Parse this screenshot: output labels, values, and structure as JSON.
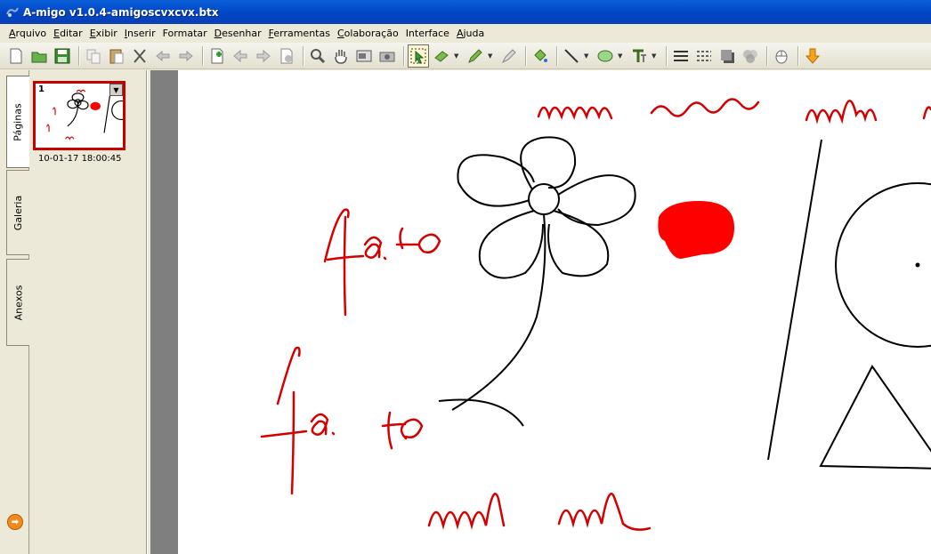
{
  "window": {
    "title": "A-migo v1.0.4-amigoscvxcvx.btx"
  },
  "menu": [
    {
      "ul": "A",
      "rest": "rquivo"
    },
    {
      "ul": "E",
      "rest": "ditar"
    },
    {
      "ul": "E",
      "rest": "xibir"
    },
    {
      "ul": "I",
      "rest": "nserir"
    },
    {
      "ul": "",
      "rest": "Formatar"
    },
    {
      "ul": "D",
      "rest": "esenhar"
    },
    {
      "ul": "F",
      "rest": "erramentas"
    },
    {
      "ul": "C",
      "rest": "olaboração"
    },
    {
      "ul": "",
      "rest": "Interface"
    },
    {
      "ul": "A",
      "rest": "juda"
    }
  ],
  "toolbar": {
    "icons": [
      "new-icon",
      "open-icon",
      "save-icon",
      "copy-icon",
      "paste-icon",
      "cut-icon",
      "undo-icon",
      "redo-icon",
      "add-page-icon",
      "previous-page-icon",
      "next-page-icon",
      "play-icon",
      "zoom-icon",
      "hand-icon",
      "screen-capture-icon",
      "camera-icon",
      "select-icon",
      "eraser-icon",
      "pen-icon",
      "highlighter-icon",
      "fill-icon",
      "line-icon",
      "shape-icon",
      "text-icon",
      "line-width-icon",
      "line-style-icon",
      "shadow-icon",
      "transparency-icon",
      "mouse-icon",
      "download-icon"
    ]
  },
  "sidebar": {
    "tabs": [
      "Páginas",
      "Galeria",
      "Anexos"
    ],
    "active_tab": "Páginas"
  },
  "pages": [
    {
      "number": "1",
      "timestamp": "10-01-17 18:00:45"
    }
  ],
  "canvas": {
    "texts": [
      "fa. to",
      "fa. to"
    ],
    "colors": {
      "ink_red": "#d40000",
      "ink_black": "#000000",
      "fill_red": "#ff0000"
    }
  }
}
